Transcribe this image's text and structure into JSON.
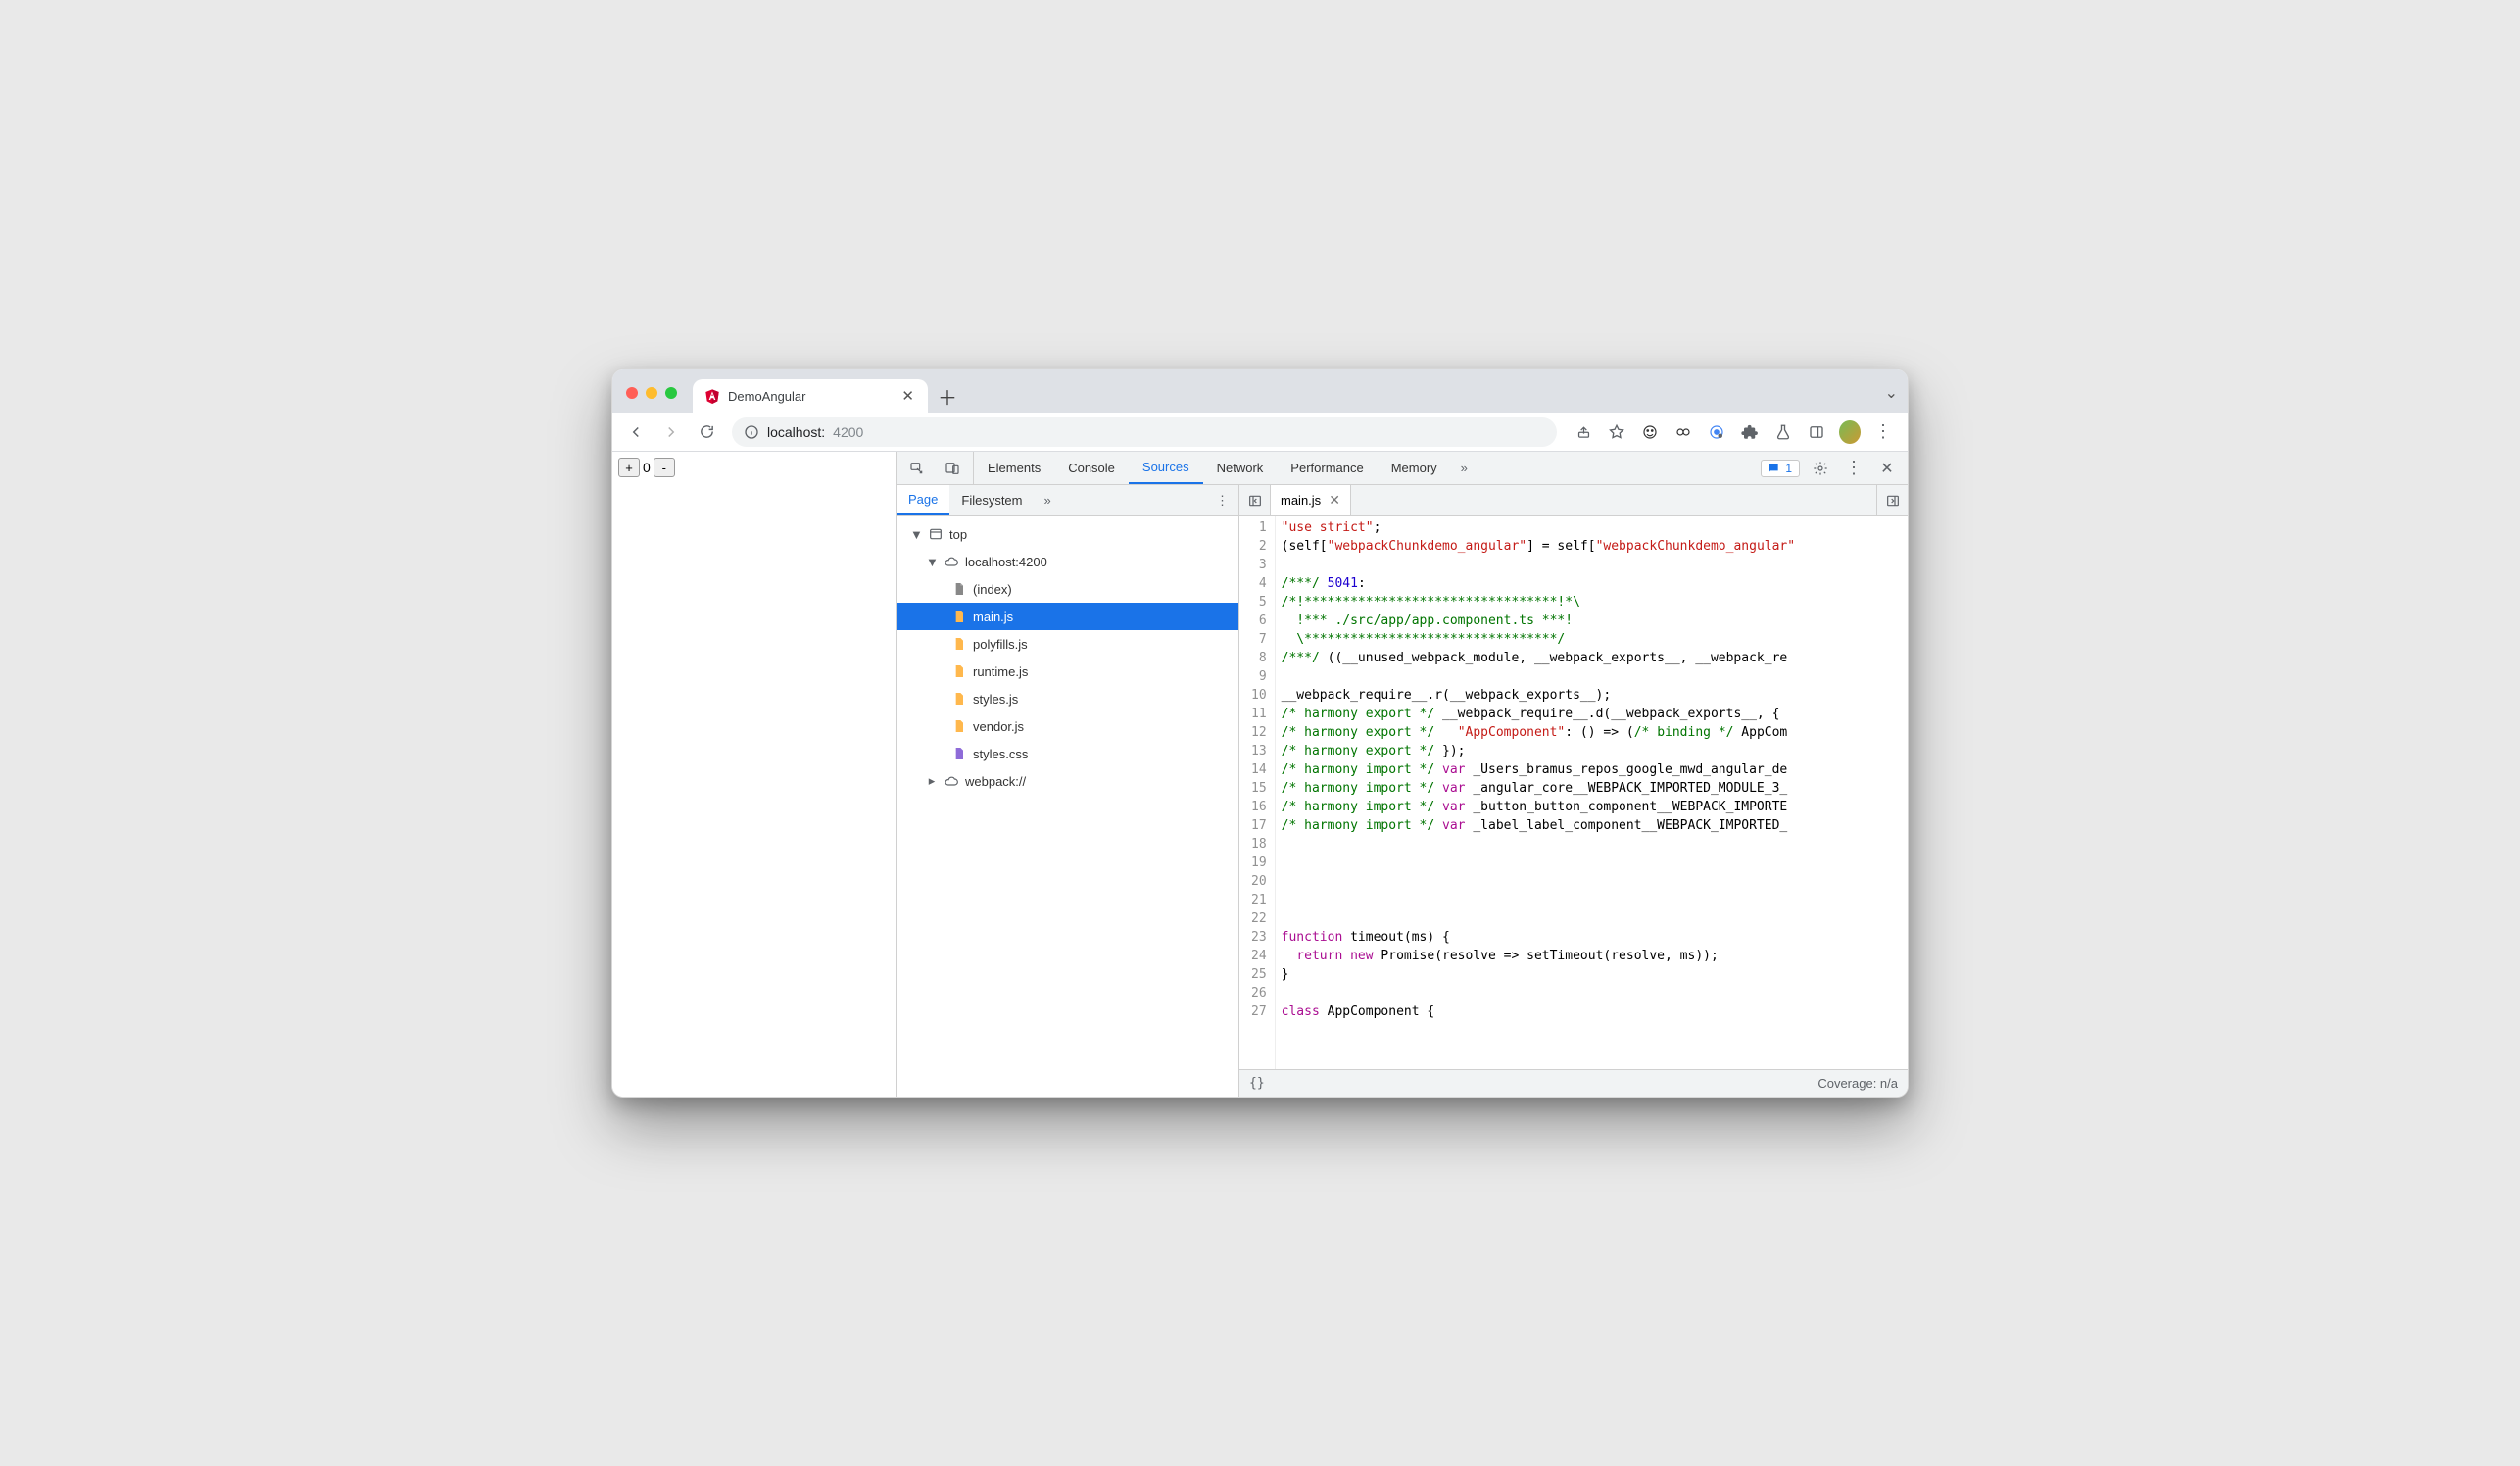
{
  "browser": {
    "tab_title": "DemoAngular",
    "url_host": "localhost:",
    "url_port": "4200",
    "counter_value": "0"
  },
  "devtools": {
    "tabs": [
      "Elements",
      "Console",
      "Sources",
      "Network",
      "Performance",
      "Memory"
    ],
    "active_tab": "Sources",
    "issues_count": "1"
  },
  "sources": {
    "nav_tabs": [
      "Page",
      "Filesystem"
    ],
    "active_nav_tab": "Page",
    "tree": {
      "top": "top",
      "origin": "localhost:4200",
      "files": [
        "(index)",
        "main.js",
        "polyfills.js",
        "runtime.js",
        "styles.js",
        "vendor.js",
        "styles.css"
      ],
      "selected": "main.js",
      "webpack": "webpack://"
    },
    "open_file": "main.js",
    "coverage": "Coverage: n/a",
    "code": [
      {
        "n": 1,
        "tokens": [
          {
            "c": "str",
            "t": "\"use strict\""
          },
          {
            "c": "",
            "t": ";"
          }
        ]
      },
      {
        "n": 2,
        "tokens": [
          {
            "c": "",
            "t": "(self["
          },
          {
            "c": "str",
            "t": "\"webpackChunkdemo_angular\""
          },
          {
            "c": "",
            "t": "] = self["
          },
          {
            "c": "str",
            "t": "\"webpackChunkdemo_angular\""
          }
        ]
      },
      {
        "n": 3,
        "tokens": []
      },
      {
        "n": 4,
        "tokens": [
          {
            "c": "cm",
            "t": "/***/ "
          },
          {
            "c": "num",
            "t": "5041"
          },
          {
            "c": "",
            "t": ":"
          }
        ]
      },
      {
        "n": 5,
        "tokens": [
          {
            "c": "cm",
            "t": "/*!*********************************!*\\"
          }
        ]
      },
      {
        "n": 6,
        "tokens": [
          {
            "c": "cm",
            "t": "  !*** ./src/app/app.component.ts ***!"
          }
        ]
      },
      {
        "n": 7,
        "tokens": [
          {
            "c": "cm",
            "t": "  \\*********************************/"
          }
        ]
      },
      {
        "n": 8,
        "tokens": [
          {
            "c": "cm",
            "t": "/***/"
          },
          {
            "c": "",
            "t": " ((__unused_webpack_module, __webpack_exports__, __webpack_re"
          }
        ]
      },
      {
        "n": 9,
        "tokens": []
      },
      {
        "n": 10,
        "tokens": [
          {
            "c": "",
            "t": "__webpack_require__.r(__webpack_exports__);"
          }
        ]
      },
      {
        "n": 11,
        "tokens": [
          {
            "c": "cm",
            "t": "/* harmony export */"
          },
          {
            "c": "",
            "t": " __webpack_require__.d(__webpack_exports__, {"
          }
        ]
      },
      {
        "n": 12,
        "tokens": [
          {
            "c": "cm",
            "t": "/* harmony export */"
          },
          {
            "c": "",
            "t": "   "
          },
          {
            "c": "str",
            "t": "\"AppComponent\""
          },
          {
            "c": "",
            "t": ": () => ("
          },
          {
            "c": "cm",
            "t": "/* binding */"
          },
          {
            "c": "",
            "t": " AppCom"
          }
        ]
      },
      {
        "n": 13,
        "tokens": [
          {
            "c": "cm",
            "t": "/* harmony export */"
          },
          {
            "c": "",
            "t": " });"
          }
        ]
      },
      {
        "n": 14,
        "tokens": [
          {
            "c": "cm",
            "t": "/* harmony import */"
          },
          {
            "c": "",
            "t": " "
          },
          {
            "c": "kw",
            "t": "var"
          },
          {
            "c": "",
            "t": " _Users_bramus_repos_google_mwd_angular_de"
          }
        ]
      },
      {
        "n": 15,
        "tokens": [
          {
            "c": "cm",
            "t": "/* harmony import */"
          },
          {
            "c": "",
            "t": " "
          },
          {
            "c": "kw",
            "t": "var"
          },
          {
            "c": "",
            "t": " _angular_core__WEBPACK_IMPORTED_MODULE_3_"
          }
        ]
      },
      {
        "n": 16,
        "tokens": [
          {
            "c": "cm",
            "t": "/* harmony import */"
          },
          {
            "c": "",
            "t": " "
          },
          {
            "c": "kw",
            "t": "var"
          },
          {
            "c": "",
            "t": " _button_button_component__WEBPACK_IMPORTE"
          }
        ]
      },
      {
        "n": 17,
        "tokens": [
          {
            "c": "cm",
            "t": "/* harmony import */"
          },
          {
            "c": "",
            "t": " "
          },
          {
            "c": "kw",
            "t": "var"
          },
          {
            "c": "",
            "t": " _label_label_component__WEBPACK_IMPORTED_"
          }
        ]
      },
      {
        "n": 18,
        "tokens": []
      },
      {
        "n": 19,
        "tokens": []
      },
      {
        "n": 20,
        "tokens": []
      },
      {
        "n": 21,
        "tokens": []
      },
      {
        "n": 22,
        "tokens": []
      },
      {
        "n": 23,
        "tokens": [
          {
            "c": "kw",
            "t": "function"
          },
          {
            "c": "",
            "t": " timeout(ms) {"
          }
        ]
      },
      {
        "n": 24,
        "tokens": [
          {
            "c": "",
            "t": "  "
          },
          {
            "c": "kw",
            "t": "return"
          },
          {
            "c": "",
            "t": " "
          },
          {
            "c": "kw",
            "t": "new"
          },
          {
            "c": "",
            "t": " Promise(resolve => setTimeout(resolve, ms));"
          }
        ]
      },
      {
        "n": 25,
        "tokens": [
          {
            "c": "",
            "t": "}"
          }
        ]
      },
      {
        "n": 26,
        "tokens": []
      },
      {
        "n": 27,
        "tokens": [
          {
            "c": "kw",
            "t": "class"
          },
          {
            "c": "",
            "t": " "
          },
          {
            "c": "id",
            "t": "AppComponent"
          },
          {
            "c": "",
            "t": " {"
          }
        ]
      }
    ]
  }
}
